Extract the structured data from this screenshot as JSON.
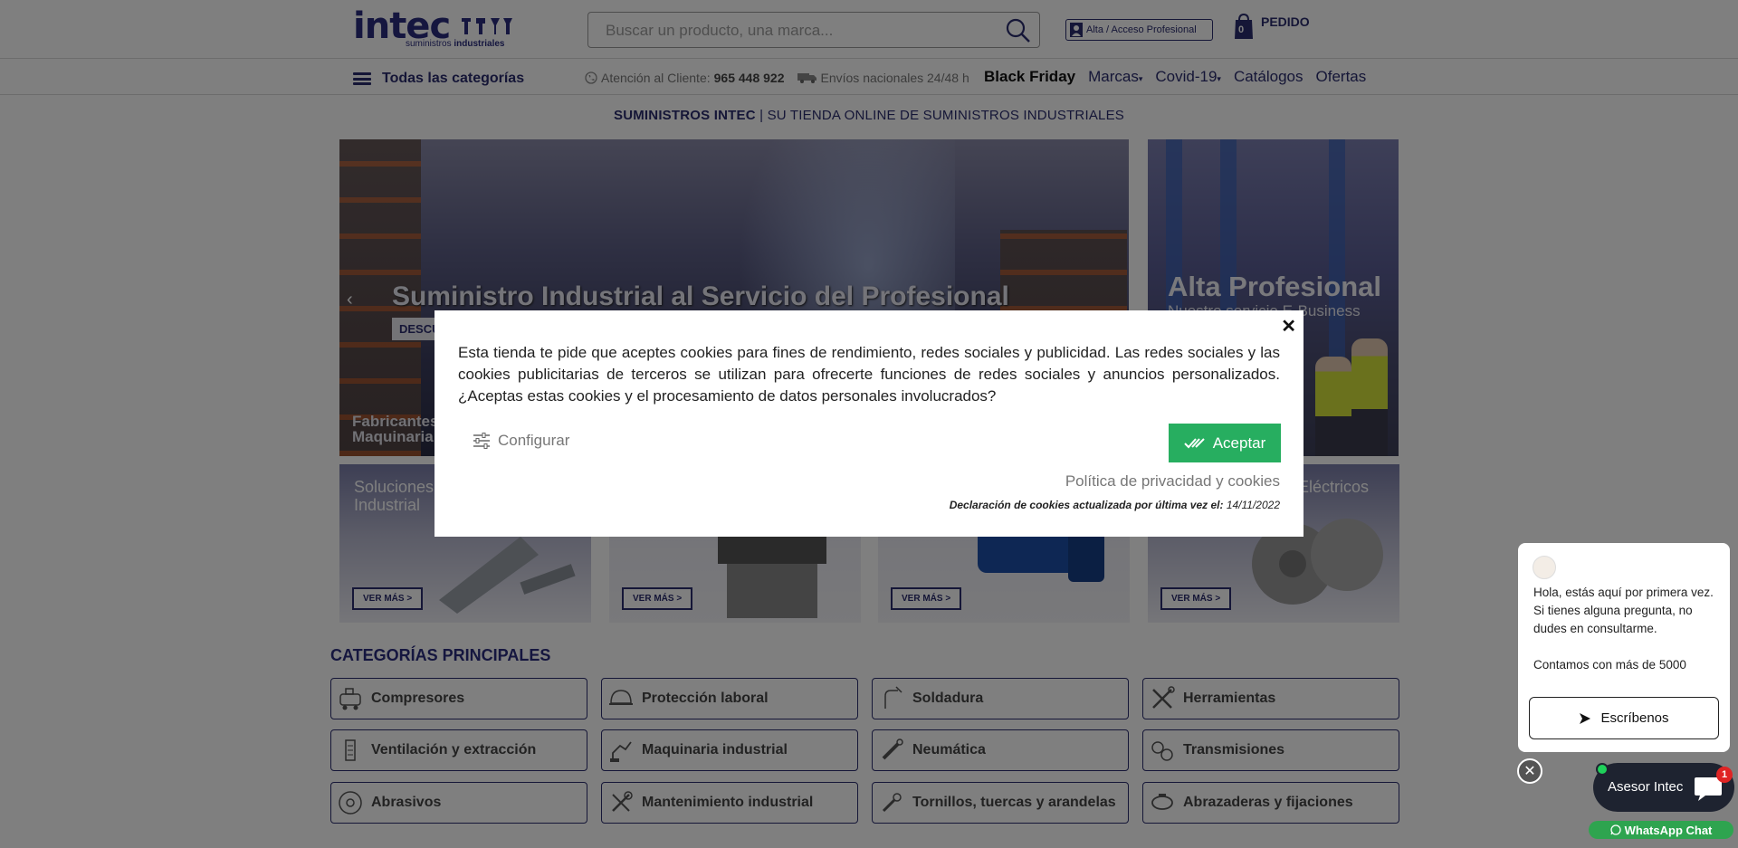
{
  "header": {
    "logo_text": "intec",
    "logo_sub_light": "suministros",
    "logo_sub_bold": "industriales",
    "search_placeholder": "Buscar un producto, una marca...",
    "pro_access_label": "Alta / Acceso Profesional",
    "cart_count": "0",
    "cart_label": "PEDIDO"
  },
  "nav": {
    "all_categories": "Todas las categorías",
    "phone_label": "Atención al Cliente:",
    "phone_number": "965 448 922",
    "shipping_text": "Envíos nacionales 24/48 h",
    "links": [
      "Black Friday",
      "Marcas",
      "Covid-19",
      "Catálogos",
      "Ofertas"
    ]
  },
  "tagline": {
    "bold": "SUMINISTROS INTEC",
    "light": " | SU TIENDA ONLINE DE SUMINISTROS INDUSTRIALES"
  },
  "hero": {
    "title": "Suministro Industrial al Servicio del Profesional",
    "button": "DESCU",
    "footer_line1": "Fabricantes",
    "footer_line2": "Maquinaria"
  },
  "side_banner": {
    "title": "Alta Profesional",
    "subtitle": "Nuestro servicio E-Business"
  },
  "tiles": [
    {
      "title": "Soluciones\nIndustrial",
      "button": "VER MÁS >"
    },
    {
      "title": "",
      "button": "VER MÁS >"
    },
    {
      "title": "",
      "button": "VER MÁS >"
    },
    {
      "title": "Eléctricos",
      "button": "VER MÁS >"
    }
  ],
  "categories": {
    "heading": "CATEGORÍAS PRINCIPALES",
    "items": [
      {
        "label": "Compresores",
        "icon": "compressor-icon"
      },
      {
        "label": "Protección laboral",
        "icon": "helmet-icon"
      },
      {
        "label": "Soldadura",
        "icon": "welding-icon"
      },
      {
        "label": "Herramientas",
        "icon": "tools-icon"
      },
      {
        "label": "Ventilación y extracción",
        "icon": "ventilation-icon"
      },
      {
        "label": "Maquinaria industrial",
        "icon": "machinery-icon"
      },
      {
        "label": "Neumática",
        "icon": "pneumatic-icon"
      },
      {
        "label": "Transmisiones",
        "icon": "transmission-icon"
      },
      {
        "label": "Abrasivos",
        "icon": "abrasive-icon"
      },
      {
        "label": "Mantenimiento industrial",
        "icon": "maintenance-icon"
      },
      {
        "label": "Tornillos, tuercas y arandelas",
        "icon": "screws-icon"
      },
      {
        "label": "Abrazaderas y fijaciones",
        "icon": "clamp-icon"
      }
    ]
  },
  "cookie_modal": {
    "text": "Esta tienda te pide que aceptes cookies para fines de rendimiento, redes sociales y publicidad. Las redes sociales y las cookies publicitarias de terceros se utilizan para ofrecerte funciones de redes sociales y anuncios personalizados. ¿Aceptas estas cookies y el procesamiento de datos personales involucrados?",
    "configure_label": "Configurar",
    "accept_label": "Aceptar",
    "policy_link": "Política de privacidad y cookies",
    "declaration_label": "Declaración de cookies actualizada por última vez el:",
    "declaration_date": "14/11/2022"
  },
  "chat": {
    "message": "Hola, estás aquí por primera vez. Si tienes alguna pregunta, no dudes en consultarme.\n\nContamos con más de 5000",
    "write_button": "Escríbenos",
    "agent_name": "Asesor Intec",
    "badge_count": "1",
    "whatsapp_label": "WhatsApp Chat"
  },
  "colors": {
    "brand": "#2b2d7e",
    "accept_green": "#27ae60",
    "whatsapp_green": "#2ea44f"
  }
}
